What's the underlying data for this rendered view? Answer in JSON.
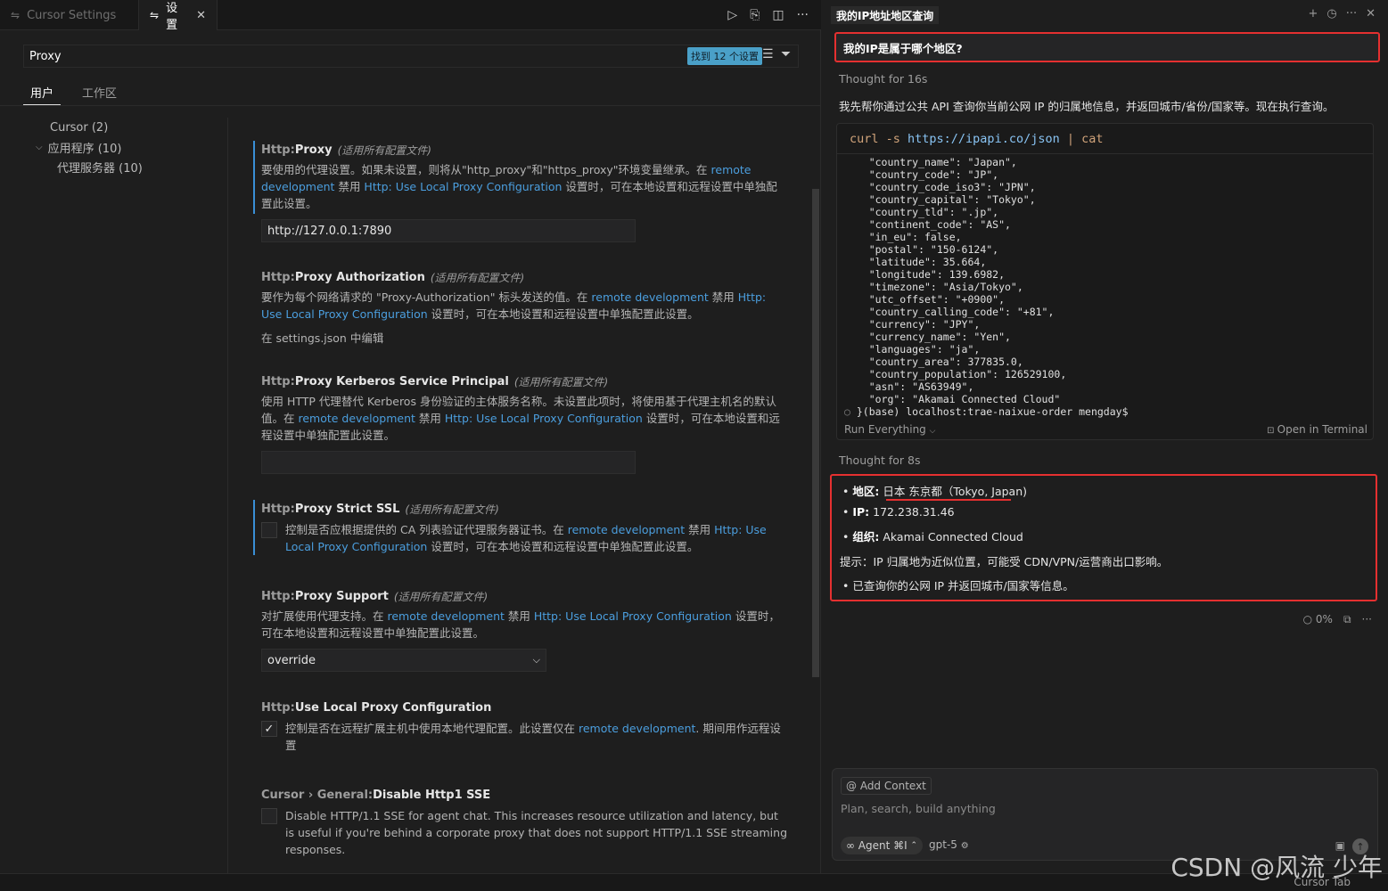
{
  "tabs": [
    {
      "label": "Cursor Settings",
      "icon": "settings-icon"
    },
    {
      "label": "设置",
      "icon": "settings-icon"
    }
  ],
  "search": {
    "value": "Proxy",
    "found": "找到 12 个设置"
  },
  "scope_tabs": [
    "用户",
    "工作区"
  ],
  "toc": [
    {
      "label": "Cursor (2)"
    },
    {
      "label": "应用程序 (10)"
    },
    {
      "label": "代理服务器 (10)"
    }
  ],
  "settings": {
    "proxy": {
      "cat": "Http: ",
      "name": "Proxy",
      "scope": "(适用所有配置文件)",
      "d1": "要使用的代理设置。如果未设置，则将从\"http_proxy\"和\"https_proxy\"环境变量继承。在 ",
      "l1": "remote development",
      "d2": " 禁用 ",
      "l2": "Http: Use Local Proxy Configuration",
      "d3": " 设置时，可在本地设置和远程设置中单独配置此设置。",
      "value": "http://127.0.0.1:7890"
    },
    "auth": {
      "cat": "Http: ",
      "name": "Proxy Authorization",
      "scope": "(适用所有配置文件)",
      "d1": "要作为每个网络请求的 \"Proxy-Authorization\" 标头发送的值。在 ",
      "l1": "remote development",
      "d2": " 禁用 ",
      "l2": "Http: Use Local Proxy Configuration",
      "d3": " 设置时，可在本地设置和远程设置中单独配置此设置。",
      "edit_link": "在 settings.json 中编辑"
    },
    "kerberos": {
      "cat": "Http: ",
      "name": "Proxy Kerberos Service Principal",
      "scope": "(适用所有配置文件)",
      "d1": "使用 HTTP 代理替代 Kerberos 身份验证的主体服务名称。未设置此项时，将使用基于代理主机名的默认值。在 ",
      "l1": "remote development",
      "d2": " 禁用 ",
      "l2": "Http: Use Local Proxy Configuration",
      "d3": " 设置时，可在本地设置和远程设置中单独配置此设置。",
      "value": ""
    },
    "strict_ssl": {
      "cat": "Http: ",
      "name": "Proxy Strict SSL",
      "scope": "(适用所有配置文件)",
      "d1": "控制是否应根据提供的 CA 列表验证代理服务器证书。在 ",
      "l1": "remote development",
      "d2": " 禁用 ",
      "l2": "Http: Use Local Proxy Configuration",
      "d3": " 设置时，可在本地设置和远程设置中单独配置此设置。"
    },
    "support": {
      "cat": "Http: ",
      "name": "Proxy Support",
      "scope": "(适用所有配置文件)",
      "d1": "对扩展使用代理支持。在 ",
      "l1": "remote development",
      "d2": " 禁用 ",
      "l2": "Http: Use Local Proxy Configuration",
      "d3": " 设置时，可在本地设置和远程设置中单独配置此设置。",
      "value": "override"
    },
    "local": {
      "cat": "Http: ",
      "name": "Use Local Proxy Configuration",
      "d1": "控制是否在远程扩展主机中使用本地代理配置。此设置仅在 ",
      "l1": "remote development",
      "d2": ". 期间用作远程设置",
      "checked": "✓"
    },
    "sse": {
      "cat": "Cursor › General: ",
      "name": "Disable Http1 SSE",
      "d1": "Disable HTTP/1.1 SSE for agent chat. This increases resource utilization and latency, but is useful if you're behind a corporate proxy that does not support HTTP/1.1 SSE streaming responses."
    }
  },
  "chat": {
    "title": "我的IP地址地区查询",
    "user_message": "我的IP是属于哪个地区?",
    "thought1": "Thought for 16s",
    "reply1": "我先帮你通过公共 API 查询你当前公网 IP 的归属地信息，并返回城市/省份/国家等。现在执行查询。",
    "cmd_pre": "curl -s ",
    "cmd_url": "https://ipapi.co/json",
    "cmd_post": " | cat",
    "term_lines": "    \"country_name\": \"Japan\",\n    \"country_code\": \"JP\",\n    \"country_code_iso3\": \"JPN\",\n    \"country_capital\": \"Tokyo\",\n    \"country_tld\": \".jp\",\n    \"continent_code\": \"AS\",\n    \"in_eu\": false,\n    \"postal\": \"150-6124\",\n    \"latitude\": 35.664,\n    \"longitude\": 139.6982,\n    \"timezone\": \"Asia/Tokyo\",\n    \"utc_offset\": \"+0900\",\n    \"country_calling_code\": \"+81\",\n    \"currency\": \"JPY\",\n    \"currency_name\": \"Yen\",\n    \"languages\": \"ja\",\n    \"country_area\": 377835.0,\n    \"country_population\": 126529100,\n    \"asn\": \"AS63949\",\n    \"org\": \"Akamai Connected Cloud\"",
    "prompt_line": "}(base) localhost:trae-naixue-order mengday$",
    "run_label": "Run Everything",
    "open_terminal": "Open in Terminal",
    "thought2": "Thought for 8s",
    "region_label": "地区:",
    "region_value": "日本 东京都（Tokyo, Japan)",
    "ip_label": "IP:",
    "ip_value": "172.238.31.46",
    "org_label": "组织:",
    "org_value": "Akamai Connected Cloud",
    "tip": "提示：IP 归属地为近似位置，可能受 CDN/VPN/运营商出口影响。",
    "summary": "已查询你的公网 IP 并返回城市/国家等信息。",
    "progress": "0%",
    "add_context": "@ Add Context",
    "placeholder": "Plan, search, build anything",
    "agent_label": "∞ Agent ⌘I",
    "model": "gpt-5",
    "status_tab": "Cursor Tab"
  },
  "watermark": "CSDN @风流 少年"
}
